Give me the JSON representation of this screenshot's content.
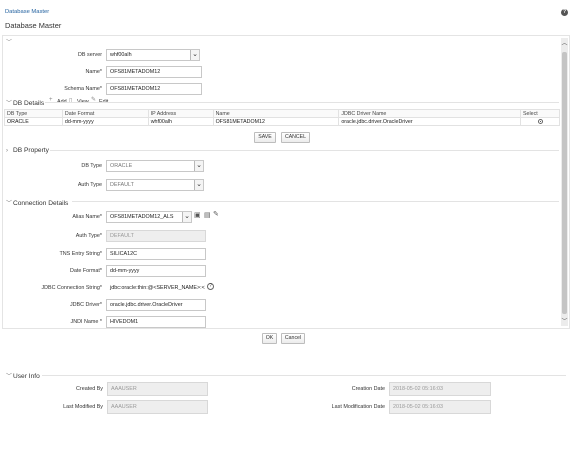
{
  "header": {
    "breadcrumb": "Database Master",
    "title": "Database Master",
    "help_icon": "help-icon"
  },
  "db_form": {
    "db_server_label": "DB server",
    "db_server_value": "whf00alh",
    "name_label": "Name*",
    "name_value": "OFS81METADOM12",
    "schema_label": "Schema Name*",
    "schema_value": "OFS81METADOM12"
  },
  "db_details": {
    "title": "DB Details",
    "add_label": "Add",
    "view_label": "View",
    "edit_label": "Edit",
    "columns": [
      "DB Type",
      "Date Format",
      "IP Address",
      "Name",
      "JDBC Driver Name",
      "Select"
    ],
    "rows": [
      [
        "ORACLE",
        "dd-mm-yyyy",
        "whf00alh",
        "OFS81METADOM12",
        "oracle.jdbc.driver.OracleDriver",
        ""
      ]
    ],
    "save_label": "SAVE",
    "cancel_label": "CANCEL"
  },
  "db_property": {
    "title": "DB Property",
    "db_type_label": "DB Type",
    "db_type_value": "ORACLE",
    "auth_type_label": "Auth Type",
    "auth_type_value": "DEFAULT"
  },
  "connection": {
    "title": "Connection Details",
    "alias_label": "Alias Name*",
    "alias_value": "OFS81METADOM12_ALS",
    "auth_type_label": "Auth Type*",
    "auth_type_value": "DEFAULT",
    "tns_label": "TNS Entry String*",
    "tns_value": "SILICA12C",
    "date_format_label": "Date Format*",
    "date_format_value": "dd-mm-yyyy",
    "jdbc_conn_label": "JDBC Connection String*",
    "jdbc_conn_value": "jdbc:oracle:thin:@<SERVER_NAME>:<F",
    "jdbc_driver_label": "JDBC Driver*",
    "jdbc_driver_value": "oracle.jdbc.driver.OracleDriver",
    "jndi_label": "JNDI Name *",
    "jndi_value": "HIVEDOM1",
    "ok_label": "OK",
    "cancel_label": "Cancel"
  },
  "user_info": {
    "title": "User Info",
    "created_by_label": "Created By",
    "created_by_value": "AAAUSER",
    "creation_date_label": "Creation Date",
    "creation_date_value": "2018-05-02 05:16:03",
    "modified_by_label": "Last Modified By",
    "modified_by_value": "AAAUSER",
    "modification_date_label": "Last Modification Date",
    "modification_date_value": "2018-05-02 05:16:03"
  }
}
